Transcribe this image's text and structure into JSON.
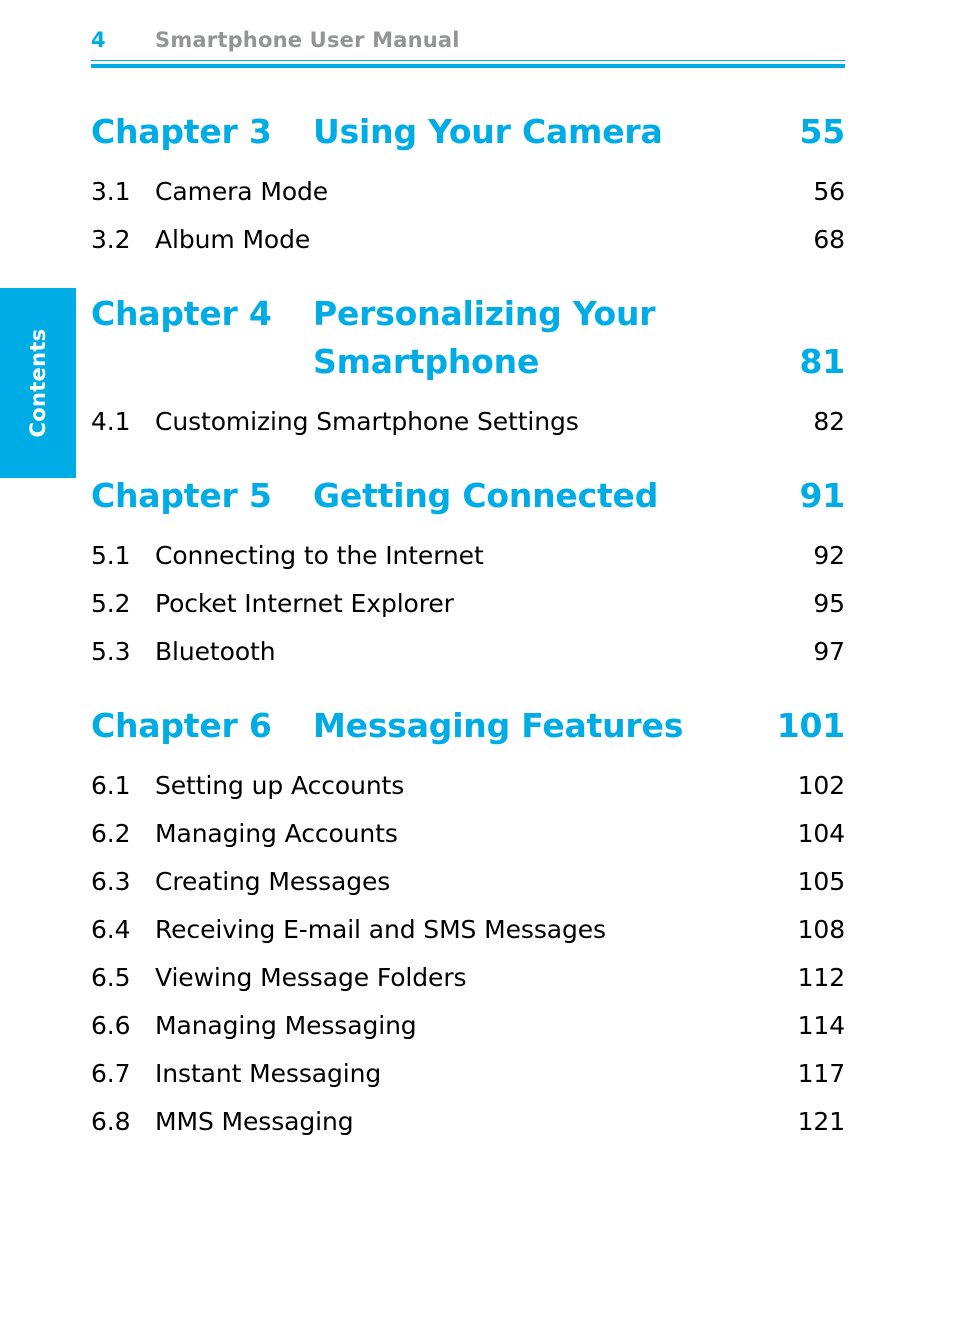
{
  "header": {
    "folio": "4",
    "doc_title": "Smartphone User Manual",
    "rule_color": "#00ace5",
    "title_color": "#939598"
  },
  "side_tab": {
    "label": "Contents",
    "background": "#00ace5",
    "text_color": "#ffffff"
  },
  "theme": {
    "accent": "#00ace5",
    "body_text": "#000000"
  },
  "toc": {
    "chapters": [
      {
        "label": "Chapter 3",
        "title": "Using Your Camera",
        "title_line2": "",
        "page": "55",
        "sections": [
          {
            "number": "3.1",
            "title": "Camera Mode",
            "page": "56"
          },
          {
            "number": "3.2",
            "title": "Album Mode",
            "page": "68"
          }
        ]
      },
      {
        "label": "Chapter 4",
        "title": "Personalizing Your",
        "title_line2": "Smartphone",
        "page": "81",
        "sections": [
          {
            "number": "4.1",
            "title": "Customizing Smartphone Settings",
            "page": "82"
          }
        ]
      },
      {
        "label": "Chapter 5",
        "title": "Getting Connected",
        "title_line2": "",
        "page": "91",
        "sections": [
          {
            "number": "5.1",
            "title": "Connecting to the Internet",
            "page": "92"
          },
          {
            "number": "5.2",
            "title": "Pocket Internet Explorer",
            "page": "95"
          },
          {
            "number": "5.3",
            "title": "Bluetooth",
            "page": "97"
          }
        ]
      },
      {
        "label": "Chapter 6",
        "title": "Messaging Features",
        "title_line2": "",
        "page": "101",
        "sections": [
          {
            "number": "6.1",
            "title": "Setting up Accounts",
            "page": "102"
          },
          {
            "number": "6.2",
            "title": "Managing Accounts",
            "page": "104"
          },
          {
            "number": "6.3",
            "title": "Creating Messages",
            "page": "105"
          },
          {
            "number": "6.4",
            "title": "Receiving E-mail and SMS Messages",
            "page": "108"
          },
          {
            "number": "6.5",
            "title": "Viewing Message Folders",
            "page": "112"
          },
          {
            "number": "6.6",
            "title": "Managing Messaging",
            "page": "114"
          },
          {
            "number": "6.7",
            "title": "Instant Messaging",
            "page": "117"
          },
          {
            "number": "6.8",
            "title": "MMS Messaging",
            "page": "121"
          }
        ]
      }
    ]
  }
}
